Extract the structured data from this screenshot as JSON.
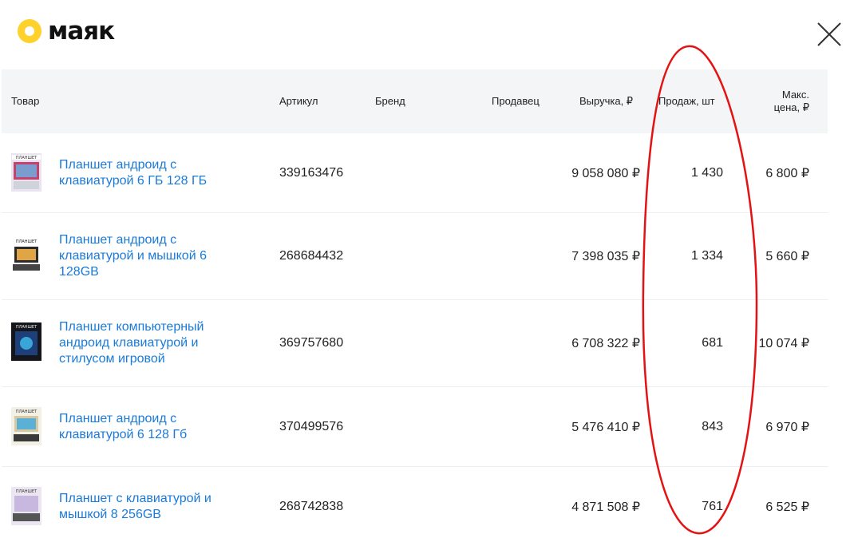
{
  "logo": {
    "text": "маяк"
  },
  "table": {
    "headers": {
      "product": "Товар",
      "article": "Артикул",
      "brand": "Бренд",
      "seller": "Продавец",
      "revenue": "Выручка, ₽",
      "sales": "Продаж, шт",
      "max_price_line1": "Макс.",
      "max_price_line2": "цена, ₽"
    },
    "rows": [
      {
        "thumb_label": "ПЛАНШЕТ",
        "name_line1": "Планшет андроид с",
        "name_line2": "клавиатурой 6 ГБ 128 ГБ",
        "name_line3": "",
        "article": "339163476",
        "brand": "",
        "seller": "",
        "revenue": "9 058 080 ₽",
        "sales": "1 430",
        "max_price": "6 800 ₽"
      },
      {
        "thumb_label": "ПЛАНШЕТ",
        "name_line1": "Планшет андроид с",
        "name_line2": "клавиатурой и мышкой 6",
        "name_line3": "128GB",
        "article": "268684432",
        "brand": "",
        "seller": "",
        "revenue": "7 398 035 ₽",
        "sales": "1 334",
        "max_price": "5 660 ₽"
      },
      {
        "thumb_label": "ПЛАНШЕТ",
        "name_line1": "Планшет компьютерный",
        "name_line2": "андроид клавиатурой и",
        "name_line3": "стилусом игровой",
        "article": "369757680",
        "brand": "",
        "seller": "",
        "revenue": "6 708 322 ₽",
        "sales": "681",
        "max_price": "10 074 ₽"
      },
      {
        "thumb_label": "ПЛАНШЕТ",
        "name_line1": "Планшет андроид с",
        "name_line2": "клавиатурой 6 128 Гб",
        "name_line3": "",
        "article": "370499576",
        "brand": "",
        "seller": "",
        "revenue": "5 476 410 ₽",
        "sales": "843",
        "max_price": "6 970 ₽"
      },
      {
        "thumb_label": "ПЛАНШЕТ",
        "name_line1": "Планшет с клавиатурой и",
        "name_line2": "мышкой 8 256GB",
        "name_line3": "",
        "article": "268742838",
        "brand": "",
        "seller": "",
        "revenue": "4 871 508 ₽",
        "sales": "761",
        "max_price": "6 525 ₽"
      }
    ]
  },
  "colors": {
    "accent_yellow": "#ffd12b",
    "link_blue": "#1a7ad9",
    "header_bg": "#f4f5f7",
    "annotation_red": "#e41212"
  },
  "icons": {
    "close": "close-icon",
    "logo": "logo-dot-icon"
  }
}
